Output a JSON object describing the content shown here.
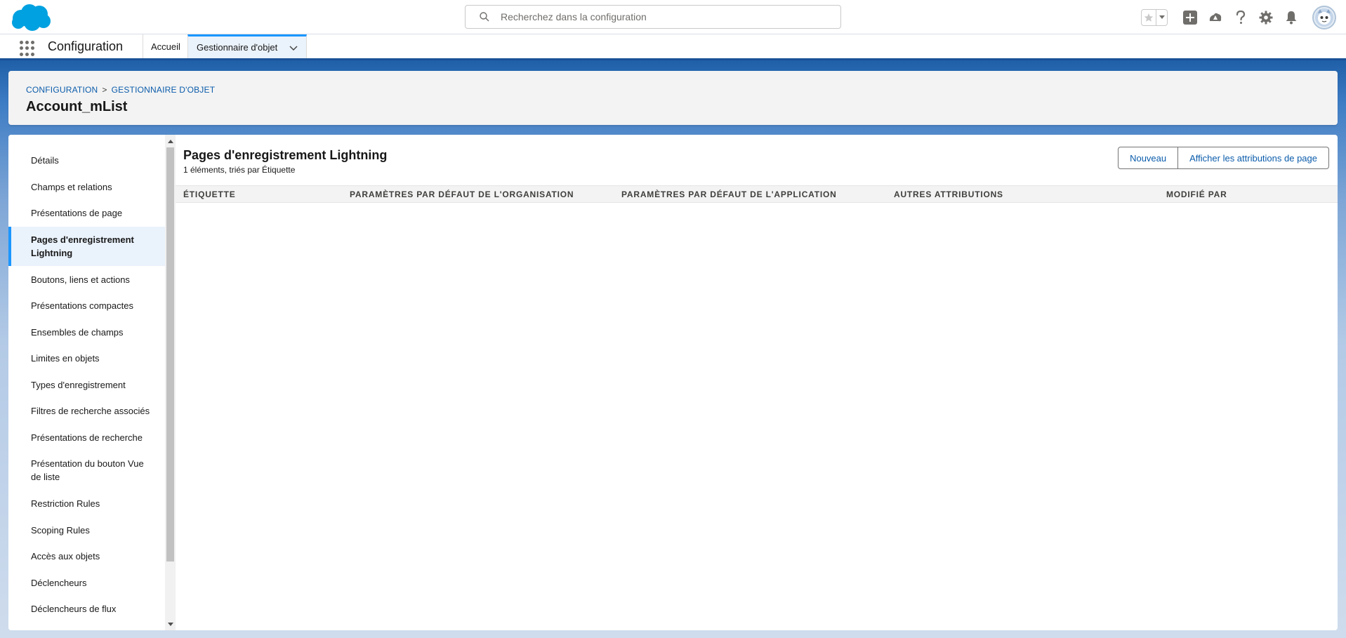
{
  "header": {
    "search_placeholder": "Recherchez dans la configuration",
    "icons": [
      "salesforce-cloud-logo",
      "search-icon",
      "favorites-star-icon",
      "favorites-dropdown-icon",
      "global-actions-plus-icon",
      "trailhead-icon",
      "help-icon",
      "setup-gear-icon",
      "notifications-bell-icon",
      "user-avatar"
    ]
  },
  "context": {
    "app_name": "Configuration",
    "tabs": [
      {
        "label": "Accueil"
      },
      {
        "label": "Gestionnaire d'objet"
      }
    ]
  },
  "page": {
    "breadcrumb": [
      "CONFIGURATION",
      "GESTIONNAIRE D'OBJET"
    ],
    "breadcrumb_sep": ">",
    "title": "Account_mList"
  },
  "sidebar": {
    "items": [
      {
        "label": "Détails"
      },
      {
        "label": "Champs et relations"
      },
      {
        "label": "Présentations de page"
      },
      {
        "label": "Pages d'enregistrement Lightning"
      },
      {
        "label": "Boutons, liens et actions"
      },
      {
        "label": "Présentations compactes"
      },
      {
        "label": "Ensembles de champs"
      },
      {
        "label": "Limites en objets"
      },
      {
        "label": "Types d'enregistrement"
      },
      {
        "label": "Filtres de recherche associés"
      },
      {
        "label": "Présentations de recherche"
      },
      {
        "label": "Présentation du bouton Vue de liste"
      },
      {
        "label": "Restriction Rules"
      },
      {
        "label": "Scoping Rules"
      },
      {
        "label": "Accès aux objets"
      },
      {
        "label": "Déclencheurs"
      },
      {
        "label": "Déclencheurs de flux"
      }
    ],
    "active_index": 3
  },
  "list": {
    "title": "Pages d'enregistrement Lightning",
    "subtitle": "1 éléments, triés par Étiquette",
    "buttons": {
      "new": "Nouveau",
      "assignments": "Afficher les attributions de page"
    },
    "columns": [
      "ÉTIQUETTE",
      "PARAMÈTRES PAR DÉFAUT DE L'ORGANISATION",
      "PARAMÈTRES PAR DÉFAUT DE L'APPLICATION",
      "AUTRES ATTRIBUTIONS",
      "MODIFIÉ PAR"
    ]
  },
  "colors": {
    "brand_blue": "#1b5297",
    "accent_blue": "#1b96ff",
    "link_blue": "#0b5cab",
    "active_bg": "#eaf2fb",
    "logo_blue": "#00a1e0"
  }
}
